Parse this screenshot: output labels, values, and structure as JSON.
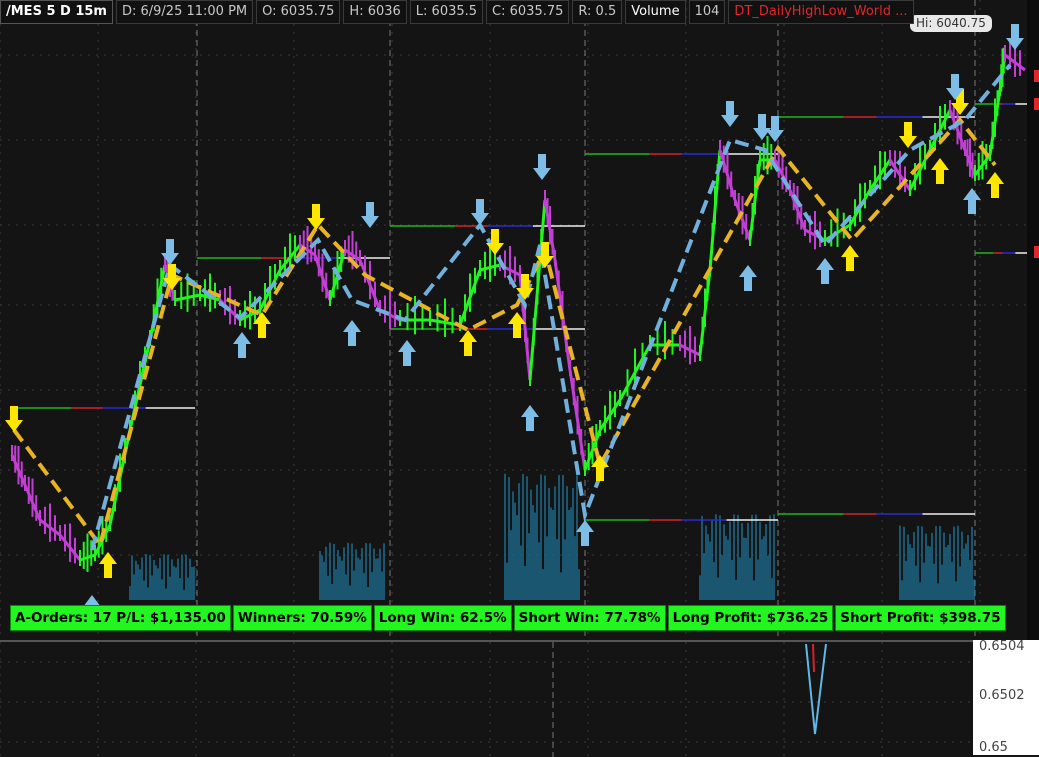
{
  "header": {
    "symbol": "/MES 5 D 15m",
    "date": "D: 6/9/25 11:00 PM",
    "open": "O: 6035.75",
    "high": "H: 6036",
    "low": "L: 6035.5",
    "close": "C: 6035.75",
    "range": "R: 0.5",
    "volume_label": "Volume",
    "volume_value": "104",
    "study": "DT_DailyHighLow_World ..."
  },
  "hi_badge": "Hi: 6040.75",
  "stats": [
    "A-Orders: 17 P/L: $1,135.00",
    "Winners: 70.59%",
    "Long Win: 62.5%",
    "Short Win: 77.78%",
    "Long Profit: $736.25",
    "Short Profit: $398.75"
  ],
  "sub_axis": [
    "0.6504",
    "0.6502",
    "0.65"
  ],
  "colors": {
    "background": "#141414",
    "price_up": "#22f51f",
    "price_down": "#c23fd3",
    "volume": "#1d6d8f",
    "buy_arrow": "#ffe600",
    "sell_arrow": "#7dbde6",
    "long_trade": "#e8b425",
    "short_trade": "#6fb0dc",
    "stats_bg": "#22f51f"
  },
  "icons": [
    "buy-arrow-icon",
    "sell-arrow-icon"
  ]
}
